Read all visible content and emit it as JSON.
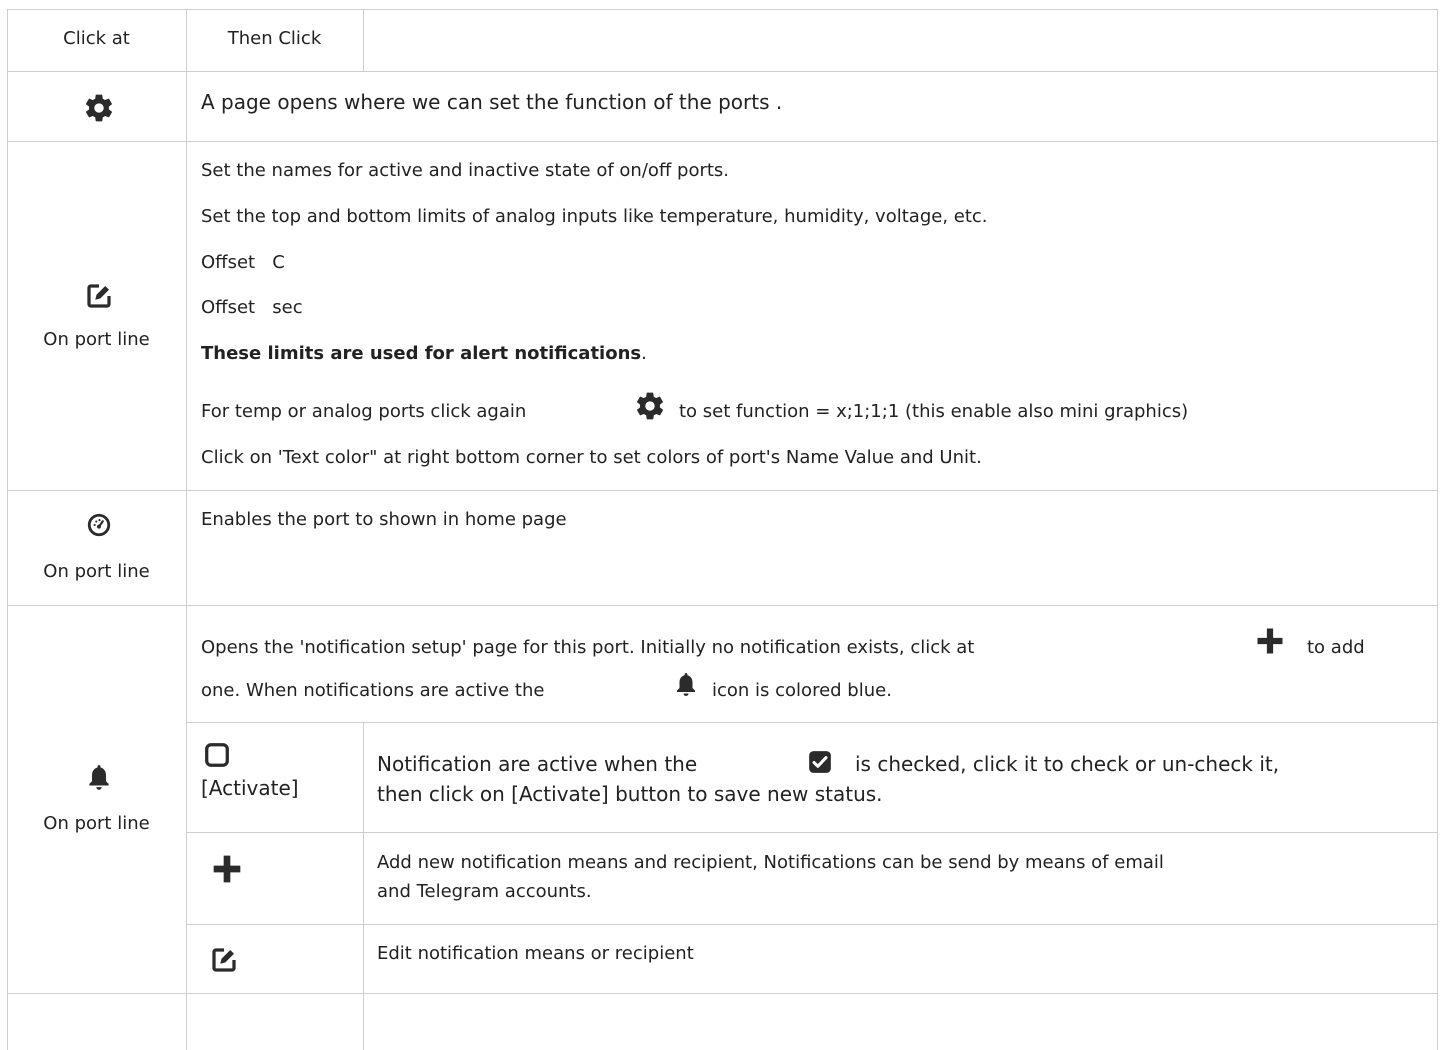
{
  "header": {
    "col1": "Click at",
    "col2": "Then Click"
  },
  "rows": {
    "gear": {
      "icon": "gear-icon",
      "text": "A page opens where we can  set the function of the ports ."
    },
    "edit": {
      "icon": "edit-icon",
      "label": "On port line",
      "lines": [
        "Set the names for active and inactive state of on/off ports.",
        "Set  the top and bottom  limits of analog inputs like temperature, humidity, voltage, etc.",
        "Offset   C",
        "Offset   sec"
      ],
      "bold_line": "These limits are used for alert notifications",
      "bold_suffix": ".",
      "func_before": "For temp or analog ports click again",
      "func_after": "to  set function =  x;1;1;1 (this enable also mini graphics)",
      "color_line": "Click on 'Text color\" at right bottom corner to set colors of port's Name Value and Unit."
    },
    "dashboard": {
      "icon": "dashboard-icon",
      "label": "On port line",
      "text": "Enables the port to shown in home page"
    },
    "bell": {
      "icon": "bell-icon",
      "label": "On port line",
      "intro_before": "Opens the 'notification setup' page for this port.  Initially no notification exists, click at",
      "intro_after": "to add",
      "intro_line2_before": "one. When notifications are active the",
      "intro_line2_after": "icon is colored blue.",
      "sub": [
        {
          "icon": "checkbox-icon",
          "label": "[Activate]",
          "text_before": "Notification are active when the",
          "text_after": "is checked, click it to check or un-check it,",
          "text_line2": "then click on [Activate] button to save new status."
        },
        {
          "icon": "plus-icon",
          "text": "Add new notification means and recipient, Notifications can be send by means of email",
          "text_line2": "and Telegram accounts."
        },
        {
          "icon": "edit-icon",
          "text": "Edit notification means or recipient"
        }
      ]
    }
  }
}
